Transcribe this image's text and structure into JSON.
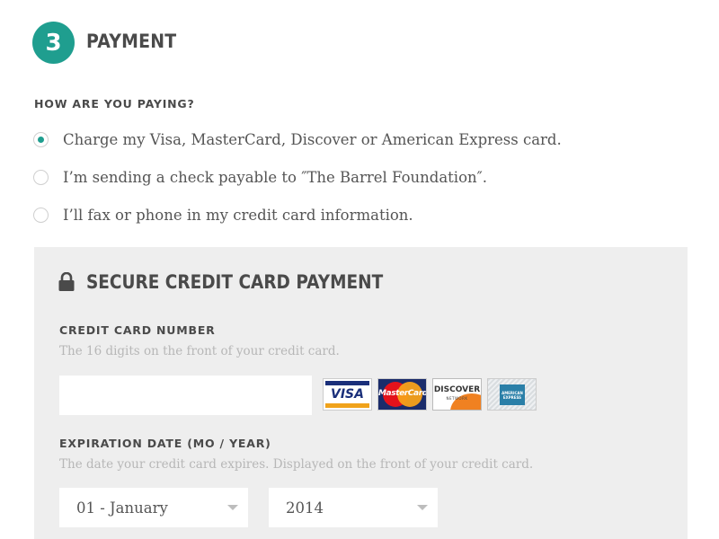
{
  "step": {
    "number": "3",
    "title": "PAYMENT"
  },
  "payment_method": {
    "question": "HOW ARE YOU PAYING?",
    "options": [
      {
        "label": "Charge my Visa, MasterCard, Discover or American Express card.",
        "selected": true
      },
      {
        "label": "I’m sending a check payable to ″The Barrel Foundation″.",
        "selected": false
      },
      {
        "label": "I’ll fax or phone in my credit card information.",
        "selected": false
      }
    ]
  },
  "secure_panel": {
    "title": "SECURE CREDIT CARD PAYMENT",
    "lock_icon": "lock-icon",
    "card_number": {
      "label": "CREDIT CARD NUMBER",
      "help": "The 16 digits on the front of your credit card.",
      "value": ""
    },
    "card_logos": [
      "VISA",
      "MasterCard",
      "DISCOVER",
      "AMERICAN EXPRESS"
    ],
    "discover_sub": "NETWORK",
    "expiration": {
      "label": "EXPIRATION DATE (MO / YEAR)",
      "help": "The date your credit card expires. Displayed on the front of your credit card.",
      "month": "01 - January",
      "year": "2014"
    }
  },
  "colors": {
    "accent": "#1f9e8f",
    "panel_bg": "#eeeeee",
    "heading": "#4a4a4a",
    "help_text": "#b7b7b7"
  }
}
